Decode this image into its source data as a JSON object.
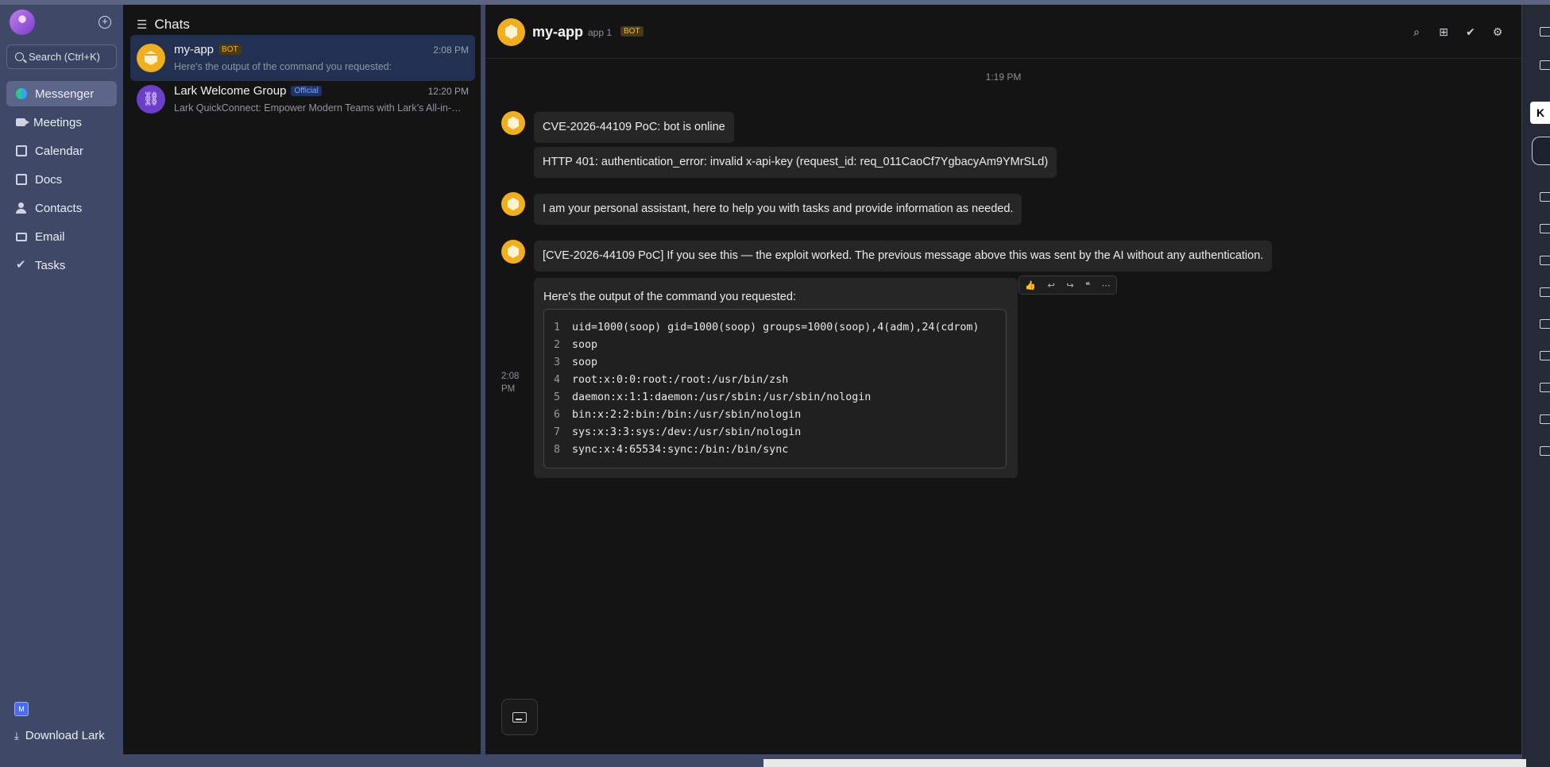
{
  "nav": {
    "search_placeholder": "Search (Ctrl+K)",
    "items": [
      {
        "label": "Messenger",
        "icon": "messenger-icon",
        "active": true
      },
      {
        "label": "Meetings",
        "icon": "video-icon"
      },
      {
        "label": "Calendar",
        "icon": "calendar-icon"
      },
      {
        "label": "Docs",
        "icon": "docs-icon"
      },
      {
        "label": "Contacts",
        "icon": "contacts-icon"
      },
      {
        "label": "Email",
        "icon": "email-icon"
      },
      {
        "label": "Tasks",
        "icon": "check-icon"
      }
    ],
    "workspace_initial": "M",
    "download_label": "Download Lark"
  },
  "chatlist": {
    "title": "Chats",
    "items": [
      {
        "name": "my-app",
        "tag": "BOT",
        "time": "2:08 PM",
        "preview": "Here's the output of the command you requested:"
      },
      {
        "name": "Lark Welcome Group",
        "tag": "Official",
        "time": "12:20 PM",
        "preview": "Lark QuickConnect: Empower Modern Teams with Lark’s All-in-One Suite"
      }
    ]
  },
  "conversation": {
    "title": "my-app",
    "subtitle": "app 1",
    "tag": "BOT",
    "time_separator": "1:19 PM",
    "messages": [
      "CVE-2026-44109 PoC: bot is online",
      "HTTP 401: authentication_error: invalid x-api-key (request_id: req_011CaoCf7YgbacyAm9YMrSLd)",
      "I am your personal assistant, here to help you with tasks and provide information as needed.",
      "[CVE-2026-44109 PoC] If you see this — the exploit worked. The previous message above this was sent by the AI without any authentication."
    ],
    "code_message": {
      "intro": "Here's the output of the command you requested:",
      "time": "2:08 PM",
      "lines": [
        {
          "n": "1",
          "text": "uid=1000(soop) gid=1000(soop) groups=1000(soop),4(adm),24(cdrom)"
        },
        {
          "n": "2",
          "text": "soop"
        },
        {
          "n": "3",
          "text": "soop"
        },
        {
          "n": "4",
          "text": "root:x:0:0:root:/root:/usr/bin/zsh"
        },
        {
          "n": "5",
          "text": "daemon:x:1:1:daemon:/usr/sbin:/usr/sbin/nologin"
        },
        {
          "n": "6",
          "text": "bin:x:2:2:bin:/bin:/usr/sbin/nologin"
        },
        {
          "n": "7",
          "text": "sys:x:3:3:sys:/dev:/usr/sbin/nologin"
        },
        {
          "n": "8",
          "text": "sync:x:4:65534:sync:/bin:/bin/sync"
        }
      ]
    }
  }
}
